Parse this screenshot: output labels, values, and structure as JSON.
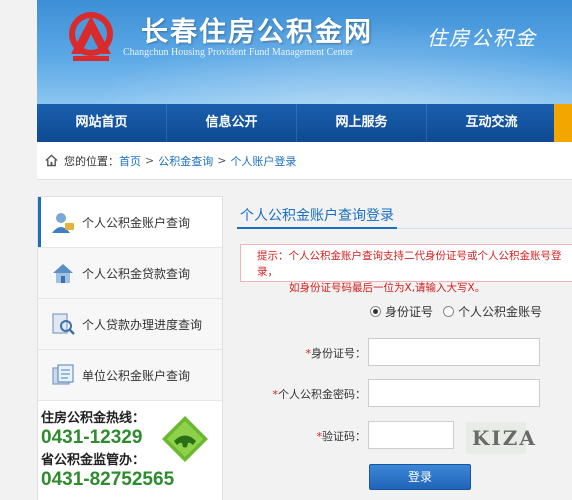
{
  "header": {
    "title_cn": "长春住房公积金网",
    "title_en": "Changchun Housing Provident Fund Management Center",
    "slogan": "住房公积金",
    "colors": {
      "banner": "#4a9ade",
      "nav": "#1256a0",
      "accent": "#f3a500"
    }
  },
  "nav": {
    "items": [
      "网站首页",
      "信息公开",
      "网上服务",
      "互动交流"
    ]
  },
  "breadcrumb": {
    "prefix": "您的位置：",
    "links": [
      "首页",
      "公积金查询",
      "个人账户登录"
    ],
    "sep": ">"
  },
  "sidebar": {
    "items": [
      {
        "label": "个人公积金账户查询",
        "icon": "user-account-icon"
      },
      {
        "label": "个人公积金贷款查询",
        "icon": "house-loan-icon"
      },
      {
        "label": "个人贷款办理进度查询",
        "icon": "progress-search-icon"
      },
      {
        "label": "单位公积金账户查询",
        "icon": "company-account-icon"
      }
    ],
    "hotline_title": "住房公积金热线：",
    "hotline_number": "0431-12329",
    "supervise_title": "省公积金监管办：",
    "supervise_number": "0431-82752565"
  },
  "main": {
    "title": "个人公积金账户查询登录",
    "tip_line1": "提示：个人公积金账户查询支持二代身份证号或个人公积金账号登录，",
    "tip_line2": "如身份证号码最后一位为X,请输入大写X。",
    "radio_options": [
      "身份证号",
      "个人公积金账号"
    ],
    "selected_radio": "身份证号",
    "fields": {
      "id_label": "身份证号：",
      "password_label": "个人公积金密码：",
      "captcha_label": "验证码：",
      "id_value": "",
      "password_value": "",
      "captcha_value": ""
    },
    "captcha_text": "KIZA",
    "login_button": "登录"
  }
}
